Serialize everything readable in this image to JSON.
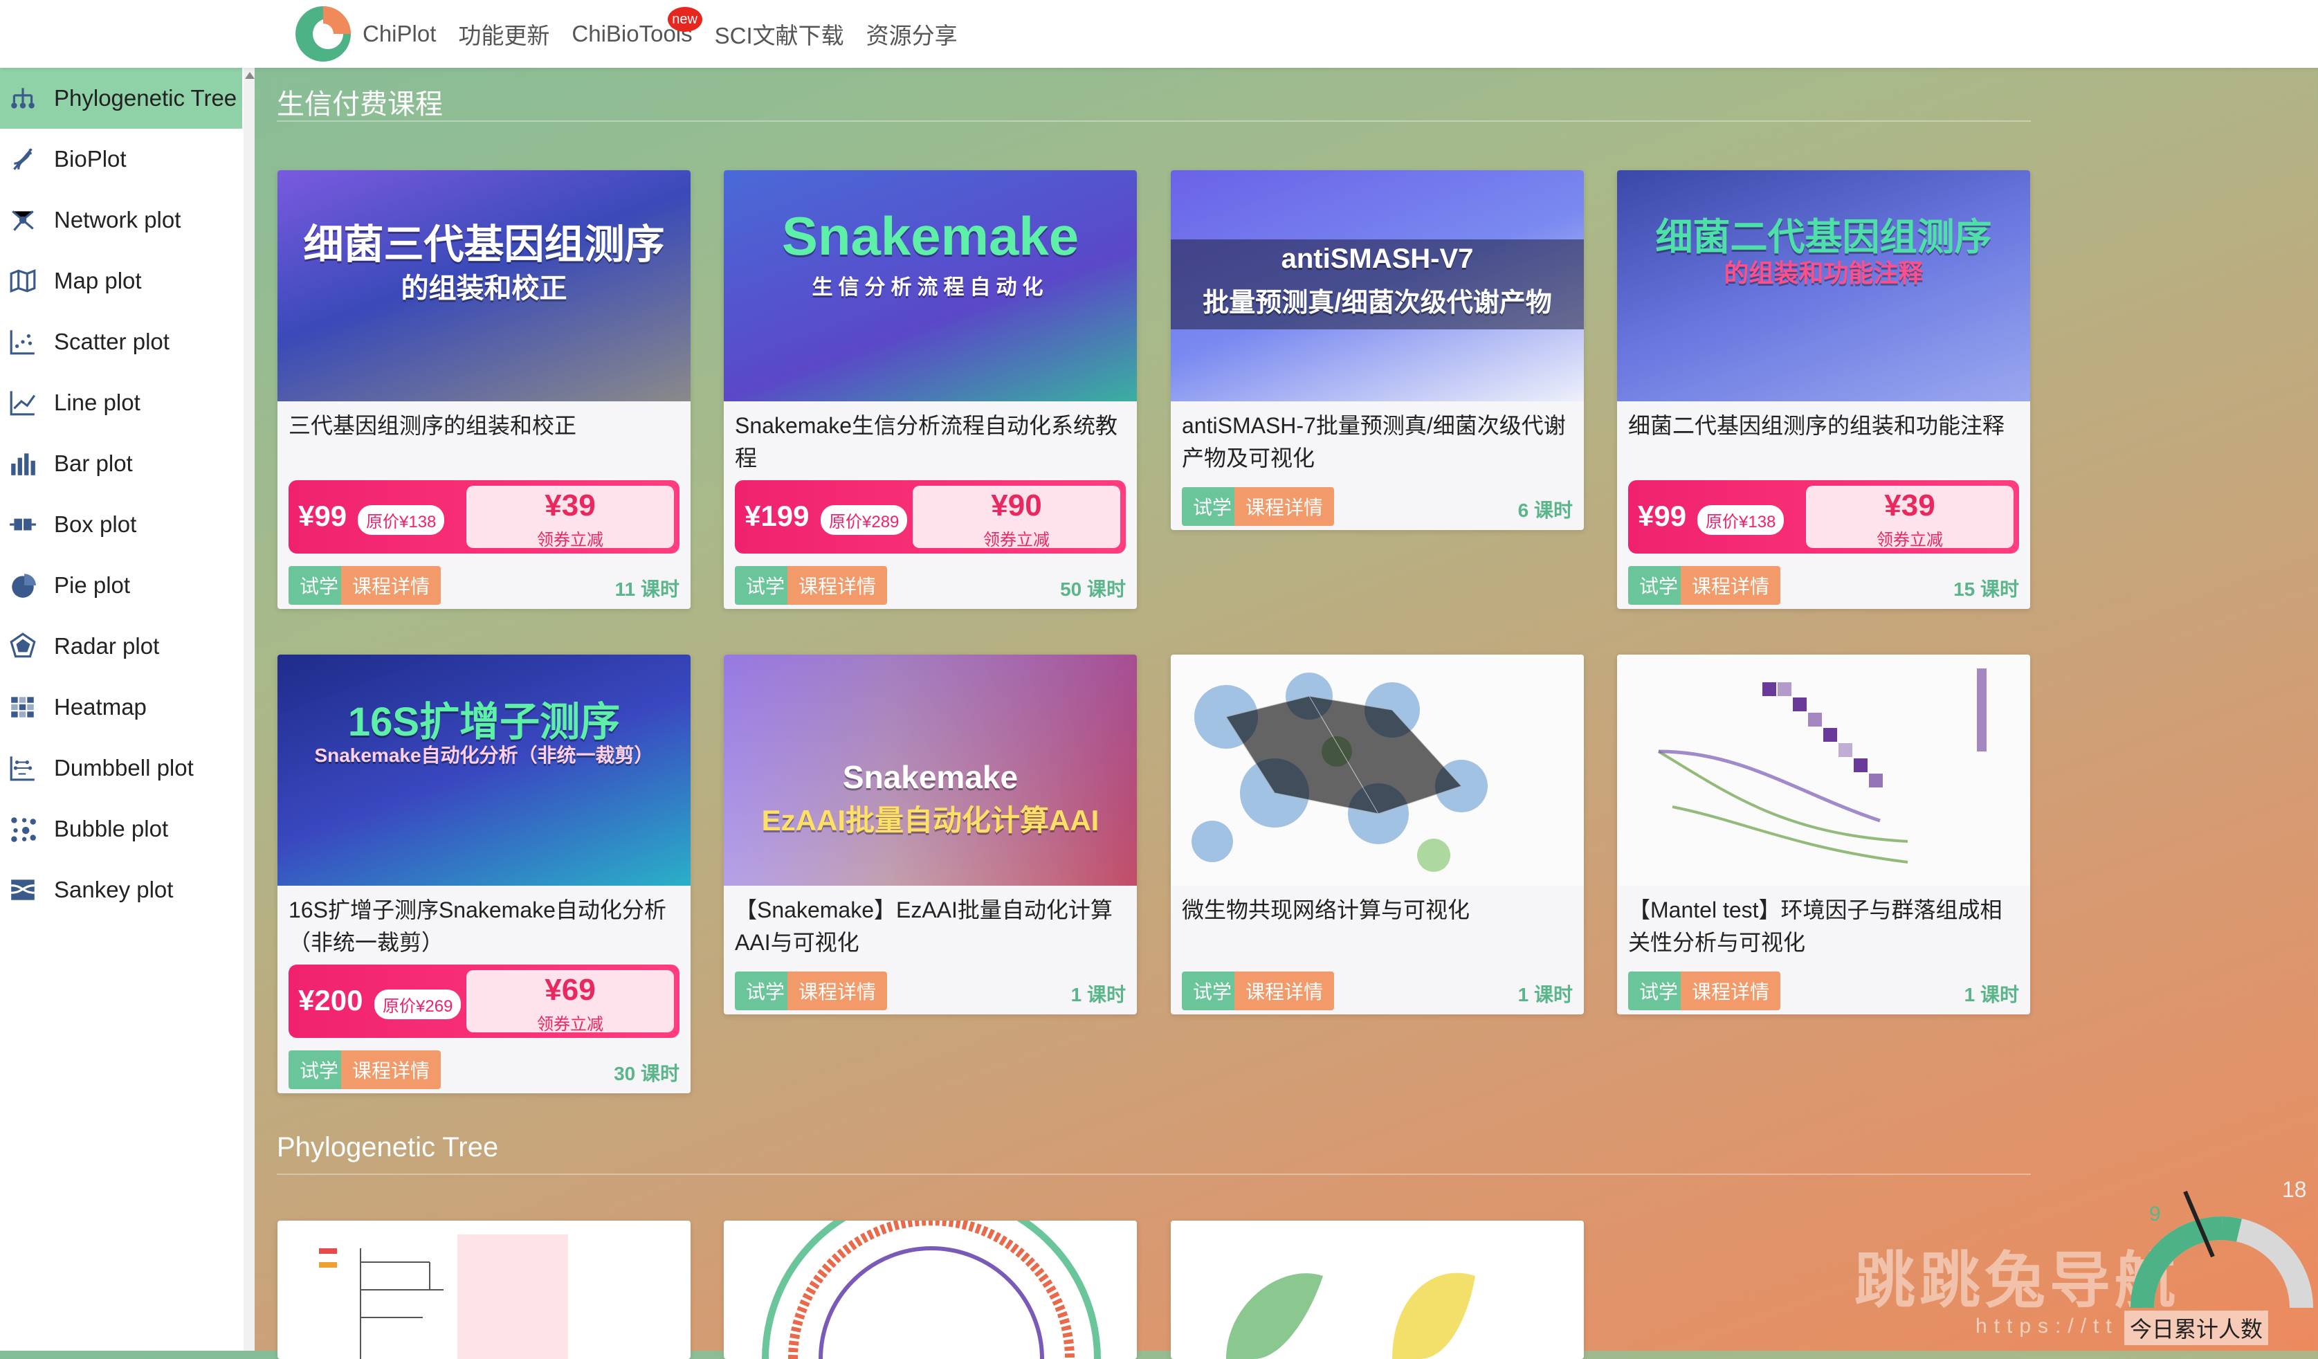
{
  "nav": {
    "logo_letter": "C",
    "items": [
      {
        "label": "ChiPlot"
      },
      {
        "label": "功能更新"
      },
      {
        "label": "ChiBioTools",
        "badge": "new"
      },
      {
        "label": "SCI文献下载"
      },
      {
        "label": "资源分享"
      }
    ]
  },
  "sidebar": {
    "items": [
      {
        "label": "Phylogenetic Tree",
        "icon": "tree-icon",
        "active": true
      },
      {
        "label": "BioPlot",
        "icon": "dna-icon"
      },
      {
        "label": "Network plot",
        "icon": "network-icon"
      },
      {
        "label": "Map plot",
        "icon": "map-icon"
      },
      {
        "label": "Scatter plot",
        "icon": "scatter-icon"
      },
      {
        "label": "Line plot",
        "icon": "line-chart-icon"
      },
      {
        "label": "Bar plot",
        "icon": "bar-chart-icon"
      },
      {
        "label": "Box plot",
        "icon": "box-plot-icon"
      },
      {
        "label": "Pie plot",
        "icon": "pie-chart-icon"
      },
      {
        "label": "Radar plot",
        "icon": "radar-icon"
      },
      {
        "label": "Heatmap",
        "icon": "heatmap-icon"
      },
      {
        "label": "Dumbbell plot",
        "icon": "dumbbell-icon"
      },
      {
        "label": "Bubble plot",
        "icon": "bubble-icon"
      },
      {
        "label": "Sankey plot",
        "icon": "sankey-icon"
      }
    ]
  },
  "sections": {
    "paid_title": "生信付费课程",
    "tree_title": "Phylogenetic Tree"
  },
  "common": {
    "try_label": "试学",
    "detail_label": "课程详情",
    "coupon_label": "领券立减"
  },
  "courses": [
    {
      "thumb_title": "细菌三代基因组测序",
      "thumb_sub": "的组装和校正",
      "title": "三代基因组测序的组装和校正",
      "price": "¥99",
      "orig": "原价¥138",
      "coupon": "¥39",
      "lessons": "11 课时"
    },
    {
      "thumb_title": "Snakemake",
      "thumb_sub": "生信分析流程自动化",
      "title": "Snakemake生信分析流程自动化系统教程",
      "price": "¥199",
      "orig": "原价¥289",
      "coupon": "¥90",
      "lessons": "50 课时"
    },
    {
      "thumb_title": "antiSMASH-V7",
      "thumb_sub": "批量预测真/细菌次级代谢产物",
      "title": "antiSMASH-7批量预测真/细菌次级代谢产物及可视化",
      "lessons": "6 课时"
    },
    {
      "thumb_title": "细菌二代基因组测序",
      "thumb_sub": "的组装和功能注释",
      "title": "细菌二代基因组测序的组装和功能注释",
      "price": "¥99",
      "orig": "原价¥138",
      "coupon": "¥39",
      "lessons": "15 课时"
    },
    {
      "thumb_title": "16S扩增子测序",
      "thumb_sub": "Snakemake自动化分析（非统一裁剪）",
      "title": "16S扩增子测序Snakemake自动化分析（非统一裁剪）",
      "price": "¥200",
      "orig": "原价¥269",
      "coupon": "¥69",
      "lessons": "30 课时"
    },
    {
      "thumb_title": "Snakemake",
      "thumb_sub": "EzAAI批量自动化计算AAI",
      "title": "【Snakemake】EzAAI批量自动化计算AAI与可视化",
      "lessons": "1 课时"
    },
    {
      "title": "微生物共现网络计算与可视化",
      "lessons": "1 课时"
    },
    {
      "title": "【Mantel test】环境因子与群落组成相关性分析与可视化",
      "lessons": "1 课时"
    }
  ],
  "gauge": {
    "value": "9",
    "max": "18",
    "label": "今日累计人数"
  },
  "watermark": {
    "text": "跳跳兔导航",
    "url": "https://tt"
  }
}
